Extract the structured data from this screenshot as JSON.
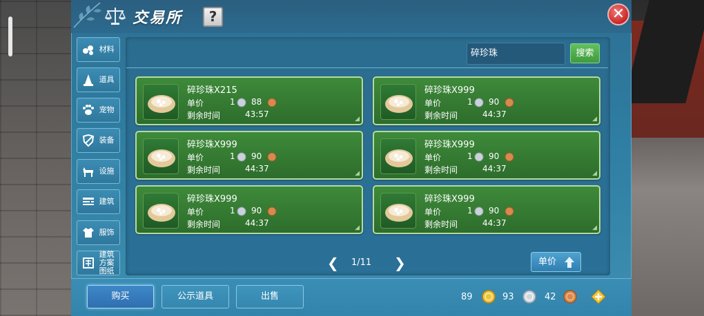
{
  "header": {
    "title": "交易所",
    "help_label": "?",
    "close_label": "✕"
  },
  "sidebar": {
    "items": [
      {
        "label": "材料",
        "icon": "materials-icon"
      },
      {
        "label": "道具",
        "icon": "props-icon"
      },
      {
        "label": "宠物",
        "icon": "pet-icon"
      },
      {
        "label": "装备",
        "icon": "equipment-icon"
      },
      {
        "label": "设施",
        "icon": "facility-icon"
      },
      {
        "label": "建筑",
        "icon": "building-icon"
      },
      {
        "label": "服饰",
        "icon": "clothing-icon"
      },
      {
        "label": "建筑方案图纸",
        "icon": "blueprint-icon"
      }
    ]
  },
  "search": {
    "value": "碎珍珠",
    "button_label": "搜索"
  },
  "listings": {
    "price_label": "单价",
    "time_label": "剩余时间",
    "items": [
      {
        "name": "碎珍珠X215",
        "silver": "1",
        "copper": "88",
        "time": "43:57"
      },
      {
        "name": "碎珍珠X999",
        "silver": "1",
        "copper": "90",
        "time": "44:37"
      },
      {
        "name": "碎珍珠X999",
        "silver": "1",
        "copper": "90",
        "time": "44:37"
      },
      {
        "name": "碎珍珠X999",
        "silver": "1",
        "copper": "90",
        "time": "44:37"
      },
      {
        "name": "碎珍珠X999",
        "silver": "1",
        "copper": "90",
        "time": "44:37"
      },
      {
        "name": "碎珍珠X999",
        "silver": "1",
        "copper": "90",
        "time": "44:37"
      }
    ]
  },
  "pager": {
    "text": "1/11",
    "prev": "❮",
    "next": "❯"
  },
  "sort": {
    "label": "单价"
  },
  "bottom_tabs": {
    "buy": "购买",
    "public_items": "公示道具",
    "sell": "出售"
  },
  "currency": {
    "gold": "89",
    "silver": "93",
    "copper": "42"
  },
  "colors": {
    "window_blue": "#2f7ea3",
    "card_green": "#3e8a3a",
    "search_green": "#4fae4c",
    "close_red": "#c92626"
  }
}
